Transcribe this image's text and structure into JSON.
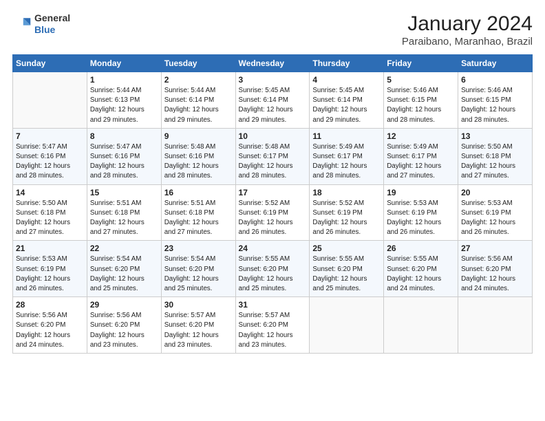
{
  "logo": {
    "line1": "General",
    "line2": "Blue"
  },
  "title": "January 2024",
  "subtitle": "Paraibano, Maranhao, Brazil",
  "headers": [
    "Sunday",
    "Monday",
    "Tuesday",
    "Wednesday",
    "Thursday",
    "Friday",
    "Saturday"
  ],
  "weeks": [
    [
      {
        "day": "",
        "info": ""
      },
      {
        "day": "1",
        "info": "Sunrise: 5:44 AM\nSunset: 6:13 PM\nDaylight: 12 hours\nand 29 minutes."
      },
      {
        "day": "2",
        "info": "Sunrise: 5:44 AM\nSunset: 6:14 PM\nDaylight: 12 hours\nand 29 minutes."
      },
      {
        "day": "3",
        "info": "Sunrise: 5:45 AM\nSunset: 6:14 PM\nDaylight: 12 hours\nand 29 minutes."
      },
      {
        "day": "4",
        "info": "Sunrise: 5:45 AM\nSunset: 6:14 PM\nDaylight: 12 hours\nand 29 minutes."
      },
      {
        "day": "5",
        "info": "Sunrise: 5:46 AM\nSunset: 6:15 PM\nDaylight: 12 hours\nand 28 minutes."
      },
      {
        "day": "6",
        "info": "Sunrise: 5:46 AM\nSunset: 6:15 PM\nDaylight: 12 hours\nand 28 minutes."
      }
    ],
    [
      {
        "day": "7",
        "info": "Sunrise: 5:47 AM\nSunset: 6:16 PM\nDaylight: 12 hours\nand 28 minutes."
      },
      {
        "day": "8",
        "info": "Sunrise: 5:47 AM\nSunset: 6:16 PM\nDaylight: 12 hours\nand 28 minutes."
      },
      {
        "day": "9",
        "info": "Sunrise: 5:48 AM\nSunset: 6:16 PM\nDaylight: 12 hours\nand 28 minutes."
      },
      {
        "day": "10",
        "info": "Sunrise: 5:48 AM\nSunset: 6:17 PM\nDaylight: 12 hours\nand 28 minutes."
      },
      {
        "day": "11",
        "info": "Sunrise: 5:49 AM\nSunset: 6:17 PM\nDaylight: 12 hours\nand 28 minutes."
      },
      {
        "day": "12",
        "info": "Sunrise: 5:49 AM\nSunset: 6:17 PM\nDaylight: 12 hours\nand 27 minutes."
      },
      {
        "day": "13",
        "info": "Sunrise: 5:50 AM\nSunset: 6:18 PM\nDaylight: 12 hours\nand 27 minutes."
      }
    ],
    [
      {
        "day": "14",
        "info": "Sunrise: 5:50 AM\nSunset: 6:18 PM\nDaylight: 12 hours\nand 27 minutes."
      },
      {
        "day": "15",
        "info": "Sunrise: 5:51 AM\nSunset: 6:18 PM\nDaylight: 12 hours\nand 27 minutes."
      },
      {
        "day": "16",
        "info": "Sunrise: 5:51 AM\nSunset: 6:18 PM\nDaylight: 12 hours\nand 27 minutes."
      },
      {
        "day": "17",
        "info": "Sunrise: 5:52 AM\nSunset: 6:19 PM\nDaylight: 12 hours\nand 26 minutes."
      },
      {
        "day": "18",
        "info": "Sunrise: 5:52 AM\nSunset: 6:19 PM\nDaylight: 12 hours\nand 26 minutes."
      },
      {
        "day": "19",
        "info": "Sunrise: 5:53 AM\nSunset: 6:19 PM\nDaylight: 12 hours\nand 26 minutes."
      },
      {
        "day": "20",
        "info": "Sunrise: 5:53 AM\nSunset: 6:19 PM\nDaylight: 12 hours\nand 26 minutes."
      }
    ],
    [
      {
        "day": "21",
        "info": "Sunrise: 5:53 AM\nSunset: 6:19 PM\nDaylight: 12 hours\nand 26 minutes."
      },
      {
        "day": "22",
        "info": "Sunrise: 5:54 AM\nSunset: 6:20 PM\nDaylight: 12 hours\nand 25 minutes."
      },
      {
        "day": "23",
        "info": "Sunrise: 5:54 AM\nSunset: 6:20 PM\nDaylight: 12 hours\nand 25 minutes."
      },
      {
        "day": "24",
        "info": "Sunrise: 5:55 AM\nSunset: 6:20 PM\nDaylight: 12 hours\nand 25 minutes."
      },
      {
        "day": "25",
        "info": "Sunrise: 5:55 AM\nSunset: 6:20 PM\nDaylight: 12 hours\nand 25 minutes."
      },
      {
        "day": "26",
        "info": "Sunrise: 5:55 AM\nSunset: 6:20 PM\nDaylight: 12 hours\nand 24 minutes."
      },
      {
        "day": "27",
        "info": "Sunrise: 5:56 AM\nSunset: 6:20 PM\nDaylight: 12 hours\nand 24 minutes."
      }
    ],
    [
      {
        "day": "28",
        "info": "Sunrise: 5:56 AM\nSunset: 6:20 PM\nDaylight: 12 hours\nand 24 minutes."
      },
      {
        "day": "29",
        "info": "Sunrise: 5:56 AM\nSunset: 6:20 PM\nDaylight: 12 hours\nand 23 minutes."
      },
      {
        "day": "30",
        "info": "Sunrise: 5:57 AM\nSunset: 6:20 PM\nDaylight: 12 hours\nand 23 minutes."
      },
      {
        "day": "31",
        "info": "Sunrise: 5:57 AM\nSunset: 6:20 PM\nDaylight: 12 hours\nand 23 minutes."
      },
      {
        "day": "",
        "info": ""
      },
      {
        "day": "",
        "info": ""
      },
      {
        "day": "",
        "info": ""
      }
    ]
  ]
}
